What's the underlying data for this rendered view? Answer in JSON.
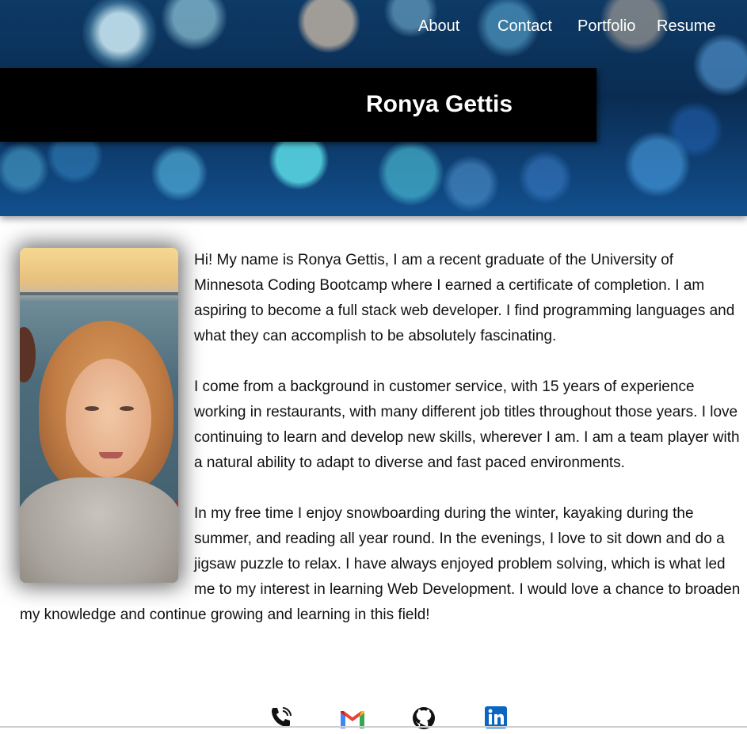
{
  "header": {
    "name": "Ronya Gettis",
    "nav": {
      "about": "About",
      "contact": "Contact",
      "portfolio": "Portfolio",
      "resume": "Resume"
    }
  },
  "about": {
    "paragraphs": [
      "Hi! My name is Ronya Gettis, I am a recent graduate of the University of Minnesota Coding Bootcamp where I earned a certificate of completion. I am aspiring to become a full stack web developer. I find programming languages and what they can accomplish to be absolutely fascinating.",
      "I come from a background in customer service, with 15 years of experience working in restaurants, with many different job titles throughout those years. I love continuing to learn and develop new skills, wherever I am. I am a team player with a natural ability to adapt to diverse and fast paced environments.",
      "In my free time I enjoy snowboarding during the winter, kayaking during the summer, and reading all year round. In the evenings, I love to sit down and do a jigsaw puzzle to relax. I have always enjoyed problem solving, which is what led me to my interest in learning Web Development. I would love a chance to broaden my knowledge and continue growing and learning in this field!"
    ]
  },
  "footer": {
    "icons": [
      "phone-icon",
      "gmail-icon",
      "github-icon",
      "linkedin-icon"
    ]
  },
  "colors": {
    "name_bar": "#000000",
    "nav_text": "#ffffff",
    "gmail_red": "#EA4335",
    "linkedin_blue": "#0A66C2"
  }
}
